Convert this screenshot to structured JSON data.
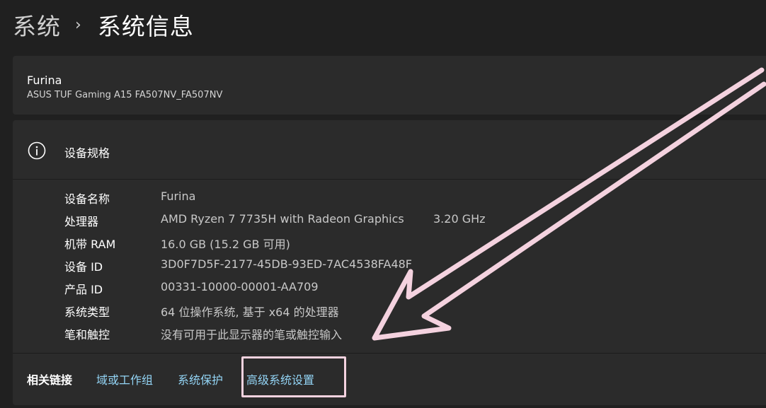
{
  "breadcrumb": {
    "parent": "系统",
    "separator": "›",
    "current": "系统信息"
  },
  "device": {
    "name": "Furina",
    "model": "ASUS TUF Gaming A15 FA507NV_FA507NV"
  },
  "specs": {
    "title": "设备规格",
    "icon": "info-icon",
    "rows": [
      {
        "label": "设备名称",
        "value": "Furina"
      },
      {
        "label": "处理器",
        "value": "AMD Ryzen 7 7735H with Radeon Graphics",
        "extra": "3.20 GHz"
      },
      {
        "label": "机带 RAM",
        "value": "16.0 GB (15.2 GB 可用)"
      },
      {
        "label": "设备 ID",
        "value": "3D0F7D5F-2177-45DB-93ED-7AC4538FA48F"
      },
      {
        "label": "产品 ID",
        "value": "00331-10000-00001-AA709"
      },
      {
        "label": "系统类型",
        "value": "64 位操作系统, 基于 x64 的处理器"
      },
      {
        "label": "笔和触控",
        "value": "没有可用于此显示器的笔或触控输入"
      }
    ]
  },
  "related_links": {
    "label": "相关链接",
    "links": [
      {
        "label": "域或工作组"
      },
      {
        "label": "系统保护"
      },
      {
        "label": "高级系统设置"
      }
    ]
  },
  "colors": {
    "background": "#202020",
    "card": "#2b2b2b",
    "link": "#93d4f5",
    "annotation": "#f4d2df"
  }
}
